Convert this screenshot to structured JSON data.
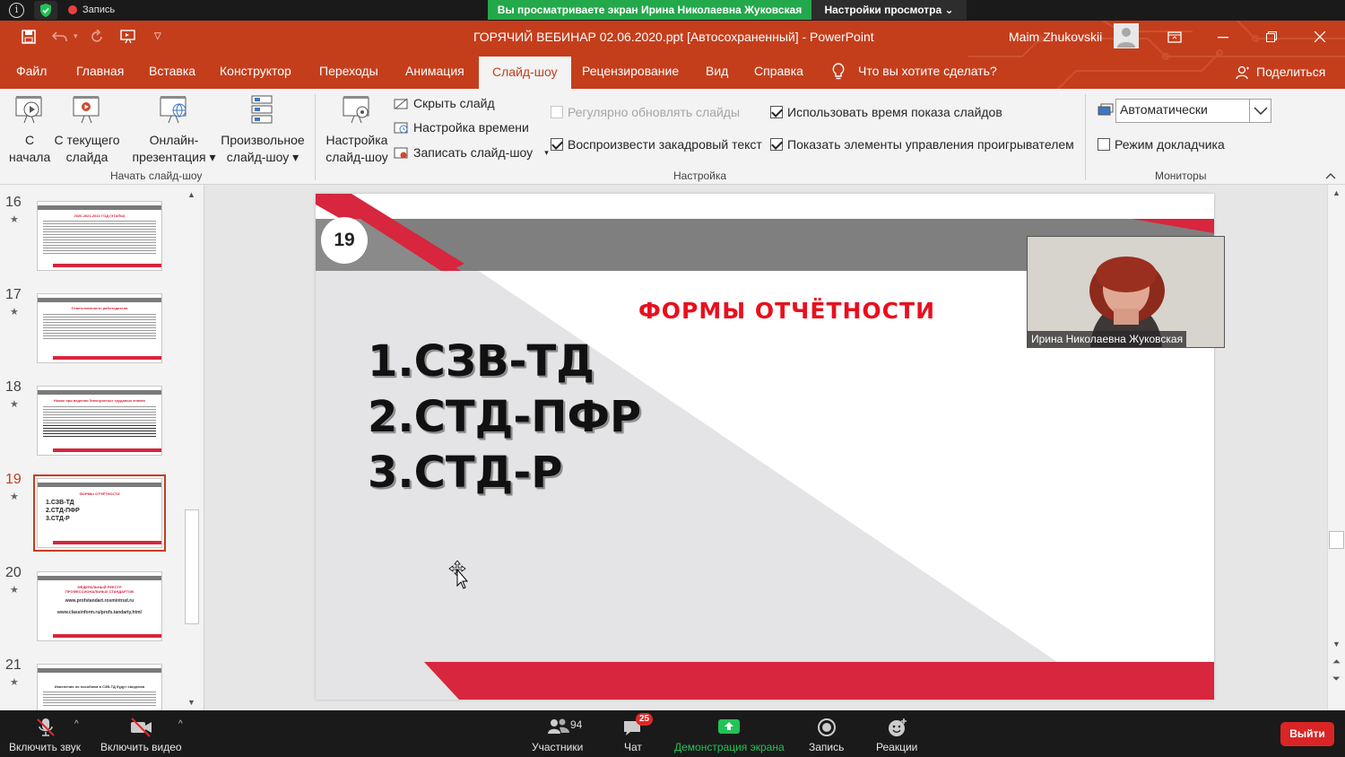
{
  "zoom_top": {
    "recording": "Запись",
    "banner": "Вы просматриваете экран Ирина Николаевна Жуковская",
    "view_options": "Настройки просмотра ⌄"
  },
  "window": {
    "title": "ГОРЯЧИЙ ВЕБИНАР 02.06.2020.ppt [Автосохраненный]  -  PowerPoint",
    "user": "Maim Zhukovskii"
  },
  "tabs": [
    "Файл",
    "Главная",
    "Вставка",
    "Конструктор",
    "Переходы",
    "Анимация",
    "Слайд-шоу",
    "Рецензирование",
    "Вид",
    "Справка"
  ],
  "tell_me": "Что вы хотите сделать?",
  "share": "Поделиться",
  "ribbon": {
    "from_start_1": "С",
    "from_start_2": "начала",
    "from_current_1": "С текущего",
    "from_current_2": "слайда",
    "online_1": "Онлайн-",
    "online_2": "презентация ▾",
    "custom_1": "Произвольное",
    "custom_2": "слайд-шоу ▾",
    "group_start": "Начать слайд-шоу",
    "setup_1": "Настройка",
    "setup_2": "слайд-шоу",
    "hide_slide": "Скрыть слайд",
    "rehearse": "Настройка времени",
    "record": "Записать слайд-шоу",
    "record_caret": "▾",
    "update_slides": "Регулярно обновлять слайды",
    "play_narration": "Воспроизвести закадровый текст",
    "use_timings": "Использовать время показа слайдов",
    "show_controls": "Показать элементы управления проигрывателем",
    "group_setup": "Настройка",
    "monitor": "Автоматически",
    "presenter_view": "Режим докладчика",
    "group_monitors": "Мониторы"
  },
  "thumbnails": [
    {
      "num": "16",
      "star": "★",
      "title": "2020-2021-2022 ГОД (ЭТАПЫ)"
    },
    {
      "num": "17",
      "star": "★",
      "title": "Ответственность работодателя"
    },
    {
      "num": "18",
      "star": "★",
      "title": "Новое при ведении Электронных трудовых книжек"
    },
    {
      "num": "19",
      "star": "★",
      "title": "ФОРМЫ ОТЧЁТНОСТИ",
      "l1": "1.СЗВ-ТД",
      "l2": "2.СТД-ПФР",
      "l3": "3.СТД-Р"
    },
    {
      "num": "20",
      "star": "★",
      "title": "ФЕДЕРАЛЬНЫЙ РЕЕСТР ПРОФЕССИОНАЛЬНЫХ СТАНДАРТОВ",
      "l1": "www.profstandart.rosmintrud.ru",
      "l2": "www.classinform.ru/profs.tandarty.html"
    },
    {
      "num": "21",
      "star": "★",
      "title": "Изменения по пособиям в СЗВ-ТД будут сведения"
    }
  ],
  "slide": {
    "number": "19",
    "title": "ФОРМЫ ОТЧЁТНОСТИ",
    "items": [
      "1.СЗВ-ТД",
      "2.СТД-ПФР",
      "3.СТД-Р"
    ]
  },
  "video": {
    "name": "Ирина Николаевна Жуковская"
  },
  "zoom_bottom": {
    "unmute": "Включить звук",
    "start_video": "Включить видео",
    "participants": "Участники",
    "participants_count": "94",
    "chat": "Чат",
    "chat_badge": "25",
    "share_screen": "Демонстрация экрана",
    "record": "Запись",
    "reactions": "Реакции",
    "leave": "Выйти"
  },
  "colors": {
    "accent": "#c43e1c",
    "slide_red": "#d7263d",
    "zoom_green": "#23a84b"
  }
}
